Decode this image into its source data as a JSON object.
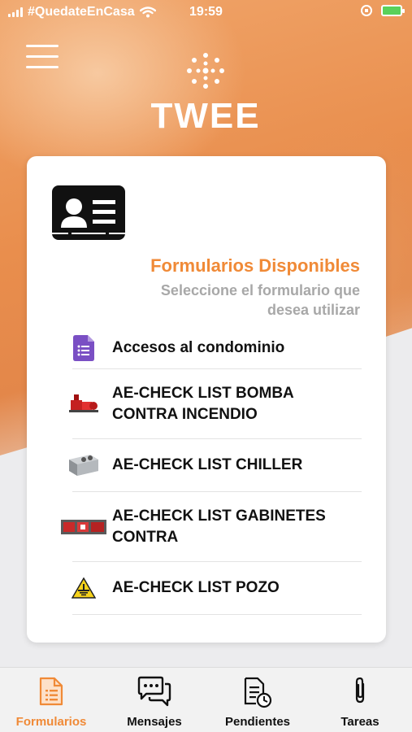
{
  "statusbar": {
    "carrier": "#QuedateEnCasa",
    "time": "19:59"
  },
  "logo": {
    "text": "TWEE"
  },
  "card": {
    "title": "Formularios Disponibles",
    "subtitle": "Seleccione el formulario que desea utilizar",
    "items": [
      {
        "label": "Accesos al condominio",
        "icon": "google-forms-icon"
      },
      {
        "label": "AE-CHECK LIST BOMBA CONTRA INCENDIO",
        "icon": "fire-pump-icon"
      },
      {
        "label": "AE-CHECK LIST CHILLER",
        "icon": "chiller-icon"
      },
      {
        "label": "AE-CHECK LIST GABINETES CONTRA",
        "icon": "fire-cabinet-icon"
      },
      {
        "label": "AE-CHECK LIST POZO",
        "icon": "ground-warning-icon"
      }
    ]
  },
  "tabs": [
    {
      "label": "Formularios",
      "icon": "form-icon",
      "active": true
    },
    {
      "label": "Mensajes",
      "icon": "chat-bubbles-icon",
      "active": false
    },
    {
      "label": "Pendientes",
      "icon": "document-clock-icon",
      "active": false
    },
    {
      "label": "Tareas",
      "icon": "paperclip-icon",
      "active": false
    }
  ],
  "colors": {
    "accent": "#f08a37",
    "background": "#ececee",
    "header_orange": "#e98e4d"
  }
}
